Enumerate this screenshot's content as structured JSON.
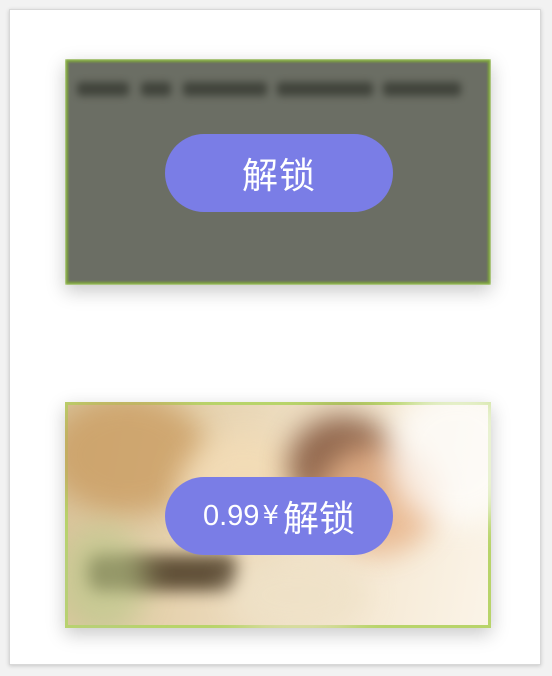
{
  "cards": [
    {
      "type": "text-preview",
      "unlock_label": "解锁"
    },
    {
      "type": "image-preview",
      "price": "0.99",
      "currency": "¥",
      "unlock_label": "解锁"
    }
  ],
  "colors": {
    "button": "#7a7de6",
    "button_text": "#ffffff",
    "card1_background": "#6b6e64",
    "card1_border": "#7fa83a",
    "card2_border": "#b8d46a"
  }
}
